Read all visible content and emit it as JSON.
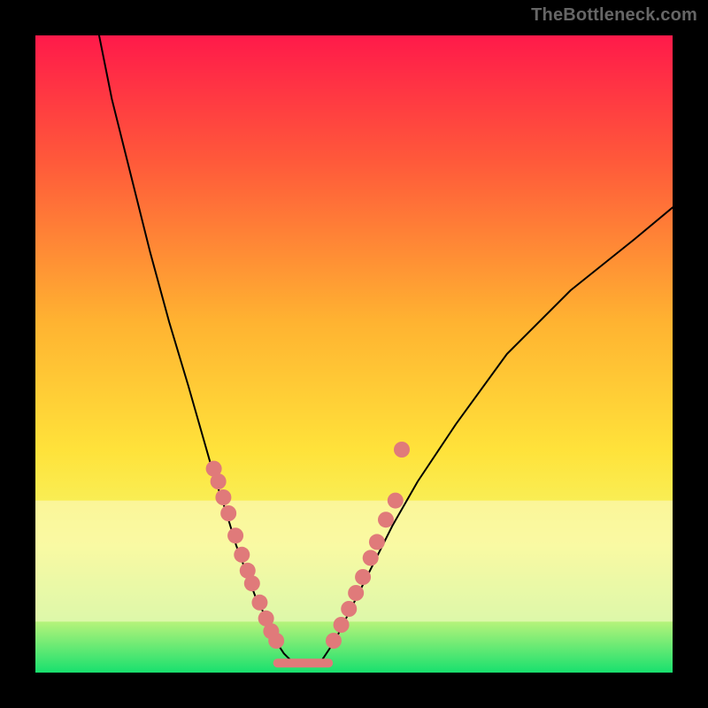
{
  "watermark": "TheBottleneck.com",
  "chart_data": {
    "type": "line",
    "title": "",
    "xlabel": "",
    "ylabel": "",
    "xlim": [
      0,
      100
    ],
    "ylim": [
      0,
      100
    ],
    "grid": false,
    "legend": false,
    "background_gradient_stops": [
      {
        "offset": 0,
        "color": "#ff1a4a"
      },
      {
        "offset": 20,
        "color": "#ff5a3a"
      },
      {
        "offset": 45,
        "color": "#ffb331"
      },
      {
        "offset": 65,
        "color": "#ffe23a"
      },
      {
        "offset": 80,
        "color": "#f4f86a"
      },
      {
        "offset": 92,
        "color": "#b6f37a"
      },
      {
        "offset": 100,
        "color": "#18e06e"
      }
    ],
    "pale_band": {
      "y_top": 73,
      "y_bottom": 92,
      "color": "#fdfcd2",
      "opacity": 0.55
    },
    "series": [
      {
        "name": "left-curve",
        "color": "#000000",
        "width": 2,
        "x": [
          10,
          12,
          15,
          18,
          21,
          24,
          26,
          28,
          30,
          31.5,
          33,
          34.5,
          36,
          37,
          38,
          39,
          40
        ],
        "y": [
          0,
          10,
          22,
          34,
          45,
          55,
          62,
          69,
          75,
          80,
          84,
          88,
          91,
          93.5,
          95.5,
          97,
          98
        ]
      },
      {
        "name": "right-curve",
        "color": "#000000",
        "width": 2,
        "x": [
          45,
          47,
          49,
          52,
          56,
          60,
          66,
          74,
          84,
          94,
          100
        ],
        "y": [
          98,
          95,
          91,
          85,
          77,
          70,
          61,
          50,
          40,
          32,
          27
        ]
      },
      {
        "name": "valley-floor",
        "color": "#e07a7a",
        "width": 10,
        "x": [
          38,
          46
        ],
        "y": [
          98.5,
          98.5
        ]
      }
    ],
    "points_left": {
      "color": "#e07a7a",
      "radius": 9,
      "x": [
        28,
        28.7,
        29.5,
        30.3,
        31.4,
        32.4,
        33.3,
        34,
        35.2,
        36.2,
        37,
        37.8
      ],
      "y": [
        68,
        70,
        72.5,
        75,
        78.5,
        81.5,
        84,
        86,
        89,
        91.5,
        93.5,
        95
      ]
    },
    "points_right": {
      "color": "#e07a7a",
      "radius": 9,
      "x": [
        46.8,
        48,
        49.2,
        50.3,
        51.4,
        52.6,
        53.6,
        55,
        56.5
      ],
      "y": [
        95,
        92.5,
        90,
        87.5,
        85,
        82,
        79.5,
        76,
        73
      ]
    },
    "points_outlier": {
      "color": "#e07a7a",
      "radius": 9,
      "x": [
        57.5
      ],
      "y": [
        65
      ]
    }
  }
}
